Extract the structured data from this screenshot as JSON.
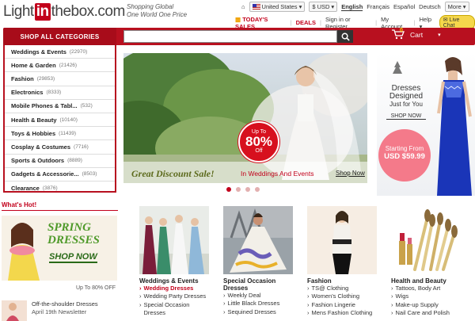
{
  "header": {
    "logo_pre": "Light",
    "logo_box": "in",
    "logo_post": "thebox.com",
    "tagline1": "Shopping Global",
    "tagline2": "One World One Price",
    "country": "United States",
    "currency": "$ USD",
    "languages": [
      "English",
      "Français",
      "Español",
      "Deutsch"
    ],
    "more": "More",
    "todays_sales": "TODAY'S SALES",
    "deals": "DEALS",
    "signin": "Sign in or Register",
    "my_account": "My Account",
    "help": "Help",
    "live_chat": "Live Chat"
  },
  "nav": {
    "shop_all": "SHOP ALL CATEGORIES",
    "search_placeholder": "",
    "cart_label": "Cart",
    "cart_count": "0"
  },
  "categories": [
    {
      "name": "Weddings & Events",
      "count": "(22970)"
    },
    {
      "name": "Home & Garden",
      "count": "(21426)"
    },
    {
      "name": "Fashion",
      "count": "(29853)"
    },
    {
      "name": "Electronics",
      "count": "(8333)"
    },
    {
      "name": "Mobile Phones & Tabl...",
      "count": "(532)"
    },
    {
      "name": "Health & Beauty",
      "count": "(10140)"
    },
    {
      "name": "Toys & Hobbies",
      "count": "(11439)"
    },
    {
      "name": "Cosplay & Costumes",
      "count": "(7716)"
    },
    {
      "name": "Sports & Outdoors",
      "count": "(8889)"
    },
    {
      "name": "Gadgets & Accessorie...",
      "count": "(8503)"
    },
    {
      "name": "Clearance",
      "count": "(3876)"
    }
  ],
  "banner": {
    "up_to": "Up To",
    "percent": "80%",
    "off": "Off",
    "great": "Great Discount Sale!",
    "in_weddings": "In Weddings And Events",
    "shop_now": "Shop Now"
  },
  "right_banner": {
    "line1": "Dresses",
    "line2": "Designed",
    "line3": "Just for You",
    "shop_now": "SHOP NOW",
    "starting": "Starting From",
    "price": "USD $59.99"
  },
  "hot": {
    "title": "What's Hot!",
    "spring": "SPRING",
    "dresses": "DRESSES",
    "shop_now": "SHOP NOW",
    "caption": "Up To 80% OFF",
    "item_title": "Off-the-shoulder Dresses",
    "item_sub": "April 19th Newsletter"
  },
  "columns": [
    {
      "title": "Weddings & Events",
      "items": [
        {
          "text": "Wedding Dresses",
          "active": true
        },
        {
          "text": "Wedding Party Dresses",
          "active": false
        },
        {
          "text": "Special Occasion Dresses",
          "active": false
        }
      ]
    },
    {
      "title": "Special Occasion Dresses",
      "items": [
        {
          "text": "Weekly Deal",
          "active": false
        },
        {
          "text": "Little Black Dresses",
          "active": false
        },
        {
          "text": "Sequined Dresses",
          "active": false
        }
      ]
    },
    {
      "title": "Fashion",
      "items": [
        {
          "text": "TS@ Clothing",
          "active": false
        },
        {
          "text": "Women's Clothing",
          "active": false
        },
        {
          "text": "Fashion Lingerie",
          "active": false
        },
        {
          "text": "Mens Fashion Clothing",
          "active": false
        }
      ]
    },
    {
      "title": "Health and Beauty",
      "items": [
        {
          "text": "Tattoos, Body Art",
          "active": false
        },
        {
          "text": "Wigs",
          "active": false
        },
        {
          "text": "Make-up Supply",
          "active": false
        },
        {
          "text": "Nail Care and Polish",
          "active": false
        }
      ]
    }
  ],
  "colors": {
    "brand_red": "#c2001b",
    "bar_red": "#b8101f"
  }
}
